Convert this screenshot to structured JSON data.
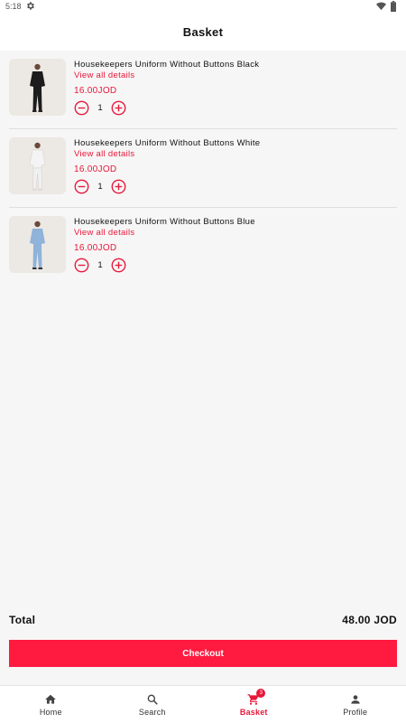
{
  "status_bar": {
    "time": "5:18",
    "icons": [
      "gear-icon",
      "wifi-icon",
      "battery-icon"
    ]
  },
  "header": {
    "title": "Basket"
  },
  "basket": {
    "items": [
      {
        "name": "Housekeepers Uniform Without Buttons Black",
        "details_link": "View all details",
        "price": "16.00JOD",
        "quantity": "1",
        "uniform_color": "#1c1c1c",
        "pants_color": "#1c1c1c"
      },
      {
        "name": "Housekeepers Uniform Without Buttons White",
        "details_link": "View all details",
        "price": "16.00JOD",
        "quantity": "1",
        "uniform_color": "#f4f4f4",
        "pants_color": "#f0f0f0"
      },
      {
        "name": "Housekeepers Uniform Without Buttons Blue",
        "details_link": "View all details",
        "price": "16.00JOD",
        "quantity": "1",
        "uniform_color": "#8fb3d9",
        "pants_color": "#8fb3d9"
      }
    ]
  },
  "summary": {
    "total_label": "Total",
    "total_value": "48.00 JOD"
  },
  "checkout": {
    "label": "Checkout"
  },
  "nav": {
    "items": [
      {
        "label": "Home",
        "icon": "home-icon"
      },
      {
        "label": "Search",
        "icon": "search-icon"
      },
      {
        "label": "Basket",
        "icon": "cart-icon",
        "badge": "3",
        "active": true
      },
      {
        "label": "Profile",
        "icon": "person-icon"
      }
    ]
  },
  "colors": {
    "accent": "#e8173a",
    "checkout_bg": "#ff1a40",
    "page_bg": "#f6f6f6"
  }
}
